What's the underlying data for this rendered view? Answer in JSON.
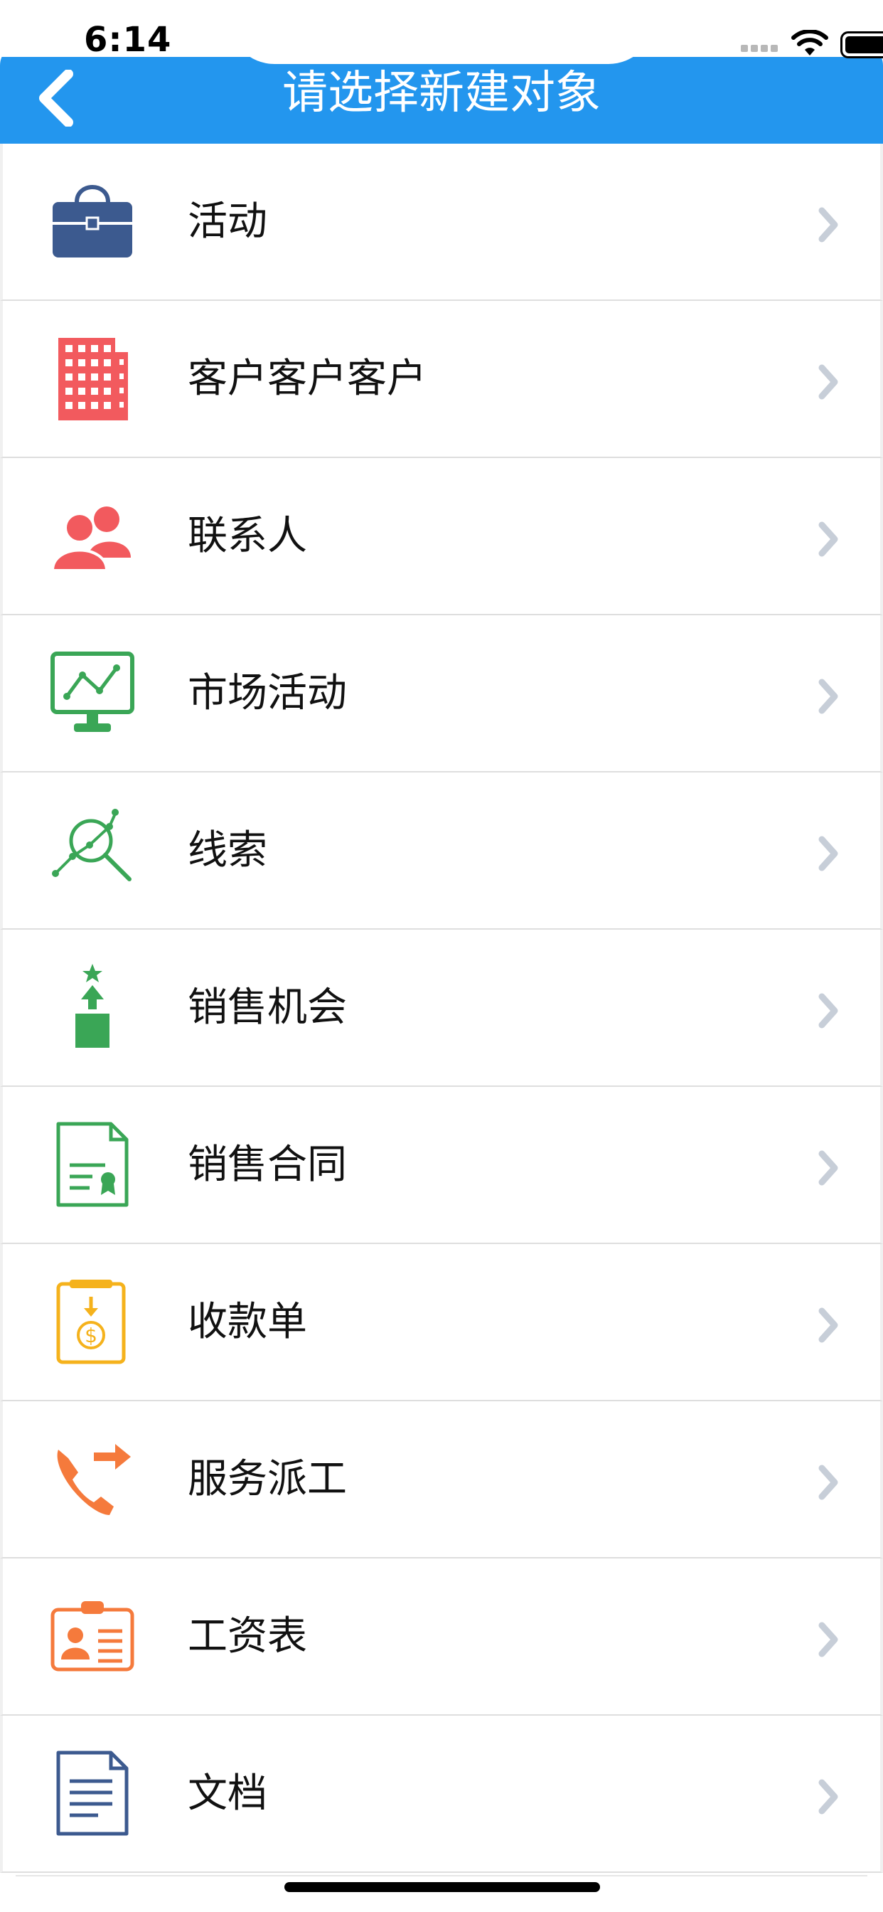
{
  "status_bar": {
    "time": "6:14"
  },
  "nav": {
    "title": "请选择新建对象",
    "back_icon": "chevron-left-icon"
  },
  "items": [
    {
      "label": "活动",
      "icon": "briefcase-icon",
      "color": "#3c5a8f"
    },
    {
      "label": "客户客户客户",
      "icon": "building-icon",
      "color": "#f25a5e"
    },
    {
      "label": "联系人",
      "icon": "people-icon",
      "color": "#f25a5e"
    },
    {
      "label": "市场活动",
      "icon": "monitor-chart-icon",
      "color": "#3aa656"
    },
    {
      "label": "线索",
      "icon": "search-trend-icon",
      "color": "#3aa656"
    },
    {
      "label": "销售机会",
      "icon": "opportunity-icon",
      "color": "#3aa656"
    },
    {
      "label": "销售合同",
      "icon": "contract-icon",
      "color": "#3aa656"
    },
    {
      "label": "收款单",
      "icon": "payment-icon",
      "color": "#f5b21c"
    },
    {
      "label": "服务派工",
      "icon": "phone-forward-icon",
      "color": "#f57a3c"
    },
    {
      "label": "工资表",
      "icon": "id-card-icon",
      "color": "#f57a3c"
    },
    {
      "label": "文档",
      "icon": "document-icon",
      "color": "#3c5a8f"
    }
  ],
  "colors": {
    "nav_bg": "#2396ee",
    "chevron": "#c7ced8"
  }
}
